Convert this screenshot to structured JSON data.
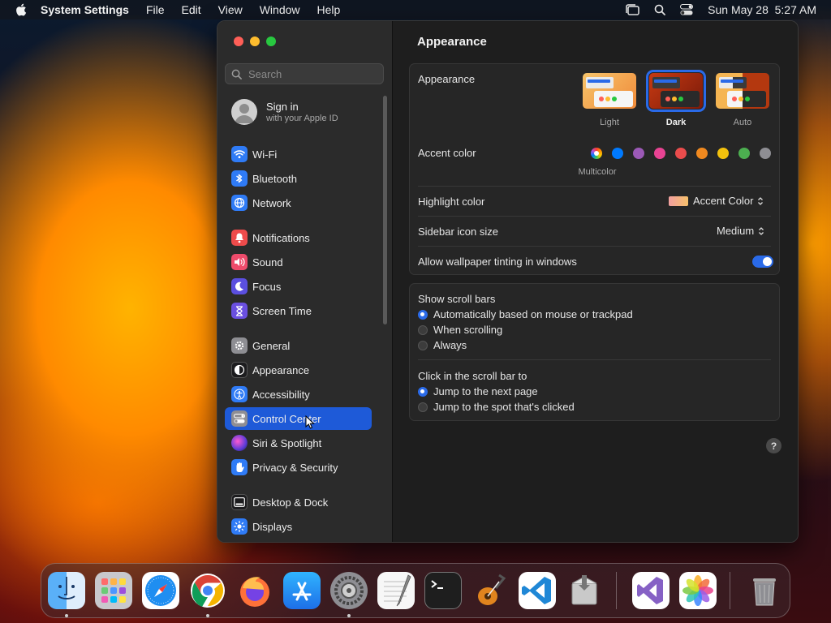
{
  "menubar": {
    "app_name": "System Settings",
    "items": [
      "File",
      "Edit",
      "View",
      "Window",
      "Help"
    ],
    "datetime": "Sun May 28  5:27 AM"
  },
  "sidebar": {
    "search_placeholder": "Search",
    "signin_title": "Sign in",
    "signin_subtitle": "with your Apple ID",
    "items": [
      {
        "label": "Wi-Fi",
        "icon": "wifi-icon",
        "color": "#2f7bf6"
      },
      {
        "label": "Bluetooth",
        "icon": "bluetooth-icon",
        "color": "#2f7bf6"
      },
      {
        "label": "Network",
        "icon": "globe-icon",
        "color": "#2f7bf6"
      },
      {
        "label": "Notifications",
        "icon": "bell-icon",
        "color": "#ee4b4b"
      },
      {
        "label": "Sound",
        "icon": "speaker-icon",
        "color": "#ee4b6b"
      },
      {
        "label": "Focus",
        "icon": "moon-icon",
        "color": "#5b4fe0"
      },
      {
        "label": "Screen Time",
        "icon": "hourglass-icon",
        "color": "#6a4fe0"
      },
      {
        "label": "General",
        "icon": "gear-icon",
        "color": "#8e8e93"
      },
      {
        "label": "Appearance",
        "icon": "appearance-icon",
        "color": "#1c1c1e"
      },
      {
        "label": "Accessibility",
        "icon": "accessibility-icon",
        "color": "#2f7bf6"
      },
      {
        "label": "Control Center",
        "icon": "control-center-icon",
        "color": "#8e8e93"
      },
      {
        "label": "Siri & Spotlight",
        "icon": "siri-icon",
        "color": "#c43bd6"
      },
      {
        "label": "Privacy & Security",
        "icon": "hand-icon",
        "color": "#2f7bf6"
      },
      {
        "label": "Desktop & Dock",
        "icon": "dock-icon",
        "color": "#1c1c1e"
      },
      {
        "label": "Displays",
        "icon": "sun-icon",
        "color": "#2f7bf6"
      }
    ],
    "selected": "Control Center"
  },
  "content": {
    "title": "Appearance",
    "appearance_label": "Appearance",
    "themes": [
      {
        "label": "Light",
        "selected": false
      },
      {
        "label": "Dark",
        "selected": true
      },
      {
        "label": "Auto",
        "selected": false
      }
    ],
    "accent_label": "Accent color",
    "accent_selected_name": "Multicolor",
    "accent_colors": [
      "#007aff",
      "#9b59b6",
      "#e84393",
      "#ea4c4c",
      "#f0891f",
      "#f4c20d",
      "#4caf50",
      "#8e8e93"
    ],
    "highlight_label": "Highlight color",
    "highlight_value": "Accent Color",
    "icon_size_label": "Sidebar icon size",
    "icon_size_value": "Medium",
    "tinting_label": "Allow wallpaper tinting in windows",
    "tinting_on": true,
    "scroll_bars_label": "Show scroll bars",
    "scroll_bar_options": [
      {
        "label": "Automatically based on mouse or trackpad",
        "selected": true
      },
      {
        "label": "When scrolling",
        "selected": false
      },
      {
        "label": "Always",
        "selected": false
      }
    ],
    "click_label": "Click in the scroll bar to",
    "click_options": [
      {
        "label": "Jump to the next page",
        "selected": true
      },
      {
        "label": "Jump to the spot that's clicked",
        "selected": false
      }
    ],
    "help": "?"
  },
  "dock": {
    "apps": [
      "Finder",
      "Launchpad",
      "Safari",
      "Google Chrome",
      "Firefox",
      "App Store",
      "System Settings",
      "TextEdit",
      "Terminal",
      "GarageBand",
      "Visual Studio Code",
      "Installer",
      "Visual Studio",
      "Photos",
      "Trash"
    ]
  }
}
